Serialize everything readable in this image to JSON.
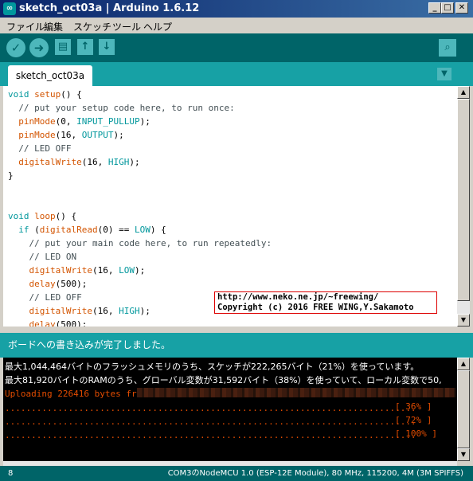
{
  "window": {
    "title": "sketch_oct03a | Arduino 1.6.12",
    "buttons": {
      "minimize": "_",
      "maximize": "□",
      "close": "✕"
    }
  },
  "menu": [
    "ファイル",
    "編集",
    "スケッチ",
    "ツール",
    "ヘルプ"
  ],
  "toolbar": {
    "verify_icon": "✓",
    "upload_icon": "➜",
    "new_icon": "▤",
    "open_icon": "↑",
    "save_icon": "↓",
    "serial_icon": "⌕",
    "icons": [
      "check-icon",
      "arrow-right-icon",
      "new-file-icon",
      "open-icon",
      "save-icon",
      "magnifier-icon"
    ]
  },
  "tabs": {
    "active": "sketch_oct03a",
    "menu_icon": "▼"
  },
  "code": [
    [
      {
        "t": "void",
        "c": "kw"
      },
      {
        "t": " "
      },
      {
        "t": "setup",
        "c": "fn"
      },
      {
        "t": "() {"
      }
    ],
    [
      {
        "t": "  // put your setup code here, to run once:",
        "c": "cm"
      }
    ],
    [
      {
        "t": "  "
      },
      {
        "t": "pinMode",
        "c": "fn"
      },
      {
        "t": "(0, "
      },
      {
        "t": "INPUT_PULLUP",
        "c": "const"
      },
      {
        "t": ");"
      }
    ],
    [
      {
        "t": "  "
      },
      {
        "t": "pinMode",
        "c": "fn"
      },
      {
        "t": "(16, "
      },
      {
        "t": "OUTPUT",
        "c": "const"
      },
      {
        "t": ");"
      }
    ],
    [
      {
        "t": "  // LED OFF",
        "c": "cm"
      }
    ],
    [
      {
        "t": "  "
      },
      {
        "t": "digitalWrite",
        "c": "fn"
      },
      {
        "t": "(16, "
      },
      {
        "t": "HIGH",
        "c": "const"
      },
      {
        "t": ");"
      }
    ],
    [
      {
        "t": "}"
      }
    ],
    [
      {
        "t": ""
      }
    ],
    [
      {
        "t": ""
      }
    ],
    [
      {
        "t": "void",
        "c": "kw"
      },
      {
        "t": " "
      },
      {
        "t": "loop",
        "c": "fn"
      },
      {
        "t": "() {"
      }
    ],
    [
      {
        "t": "  "
      },
      {
        "t": "if",
        "c": "kw"
      },
      {
        "t": " ("
      },
      {
        "t": "digitalRead",
        "c": "fn"
      },
      {
        "t": "(0) == "
      },
      {
        "t": "LOW",
        "c": "const"
      },
      {
        "t": ") {"
      }
    ],
    [
      {
        "t": "    // put your main code here, to run repeatedly:",
        "c": "cm"
      }
    ],
    [
      {
        "t": "    // LED ON",
        "c": "cm"
      }
    ],
    [
      {
        "t": "    "
      },
      {
        "t": "digitalWrite",
        "c": "fn"
      },
      {
        "t": "(16, "
      },
      {
        "t": "LOW",
        "c": "const"
      },
      {
        "t": ");"
      }
    ],
    [
      {
        "t": "    "
      },
      {
        "t": "delay",
        "c": "fn"
      },
      {
        "t": "(500);"
      }
    ],
    [
      {
        "t": "    // LED OFF",
        "c": "cm"
      }
    ],
    [
      {
        "t": "    "
      },
      {
        "t": "digitalWrite",
        "c": "fn"
      },
      {
        "t": "(16, "
      },
      {
        "t": "HIGH",
        "c": "const"
      },
      {
        "t": ");"
      }
    ],
    [
      {
        "t": "    "
      },
      {
        "t": "delay",
        "c": "fn"
      },
      {
        "t": "(500);"
      }
    ],
    [
      {
        "t": "  }"
      }
    ]
  ],
  "watermark": {
    "line1": "http://www.neko.ne.jp/~freewing/",
    "line2": "Copyright (c) 2016 FREE WING,Y.Sakamoto"
  },
  "status": "ボードへの書き込みが完了しました。",
  "console": {
    "line1": "最大1,044,464バイトのフラッシュメモリのうち、スケッチが222,265バイト（21%）を使っています。",
    "line2": "最大81,920バイトのRAMのうち、グローバル変数が31,592バイト（38%）を使っていて、ローカル変数で50,",
    "line3": "Uploading 226416 bytes from",
    "dots": "..............................................................................",
    "progress": [
      "[ 36% ]",
      "[ 72% ]",
      "[ 100% ]"
    ]
  },
  "bottom": {
    "line": "8",
    "board": "COM3のNodeMCU 1.0 (ESP-12E Module), 80 MHz, 115200, 4M (3M SPIFFS)"
  },
  "colors": {
    "teal_dark": "#006468",
    "teal": "#17a1a5",
    "orange": "#e34c00"
  }
}
